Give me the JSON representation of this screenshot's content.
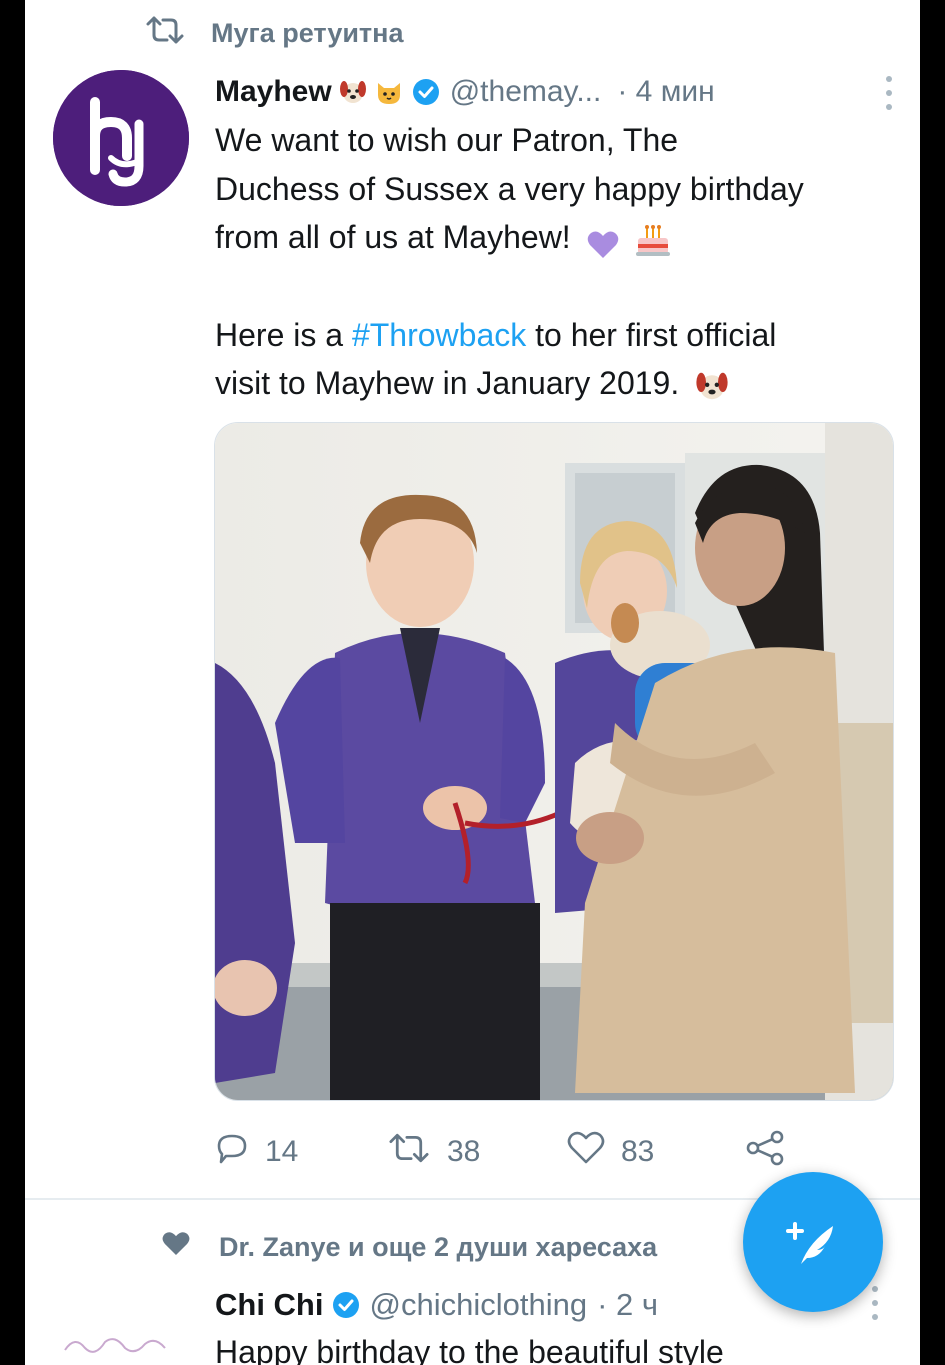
{
  "retweet_note": "Мyга ретуитна",
  "tweet": {
    "author": {
      "name": "Mayhew",
      "handle": "@themay...",
      "time": "· 4 мин",
      "emojis": [
        "dog-face-icon",
        "cat-face-icon"
      ],
      "avatar_color": "#4d1e7b"
    },
    "text_line1": "We want to wish our Patron, The",
    "text_line2": "Duchess of Sussex a very happy birthday",
    "text_line3": "from all of us at Mayhew!",
    "text_line3_emojis": [
      "purple-heart-icon",
      "birthday-cake-icon"
    ],
    "text_line4_prefix": "Here is a ",
    "hashtag": "#Throwback",
    "text_line4_suffix": " to her first official",
    "text_line5": "visit to Mayhew in January 2019.",
    "text_line5_emoji": "dog-face-icon",
    "media_description": "photo",
    "stats": {
      "replies": "14",
      "retweets": "38",
      "likes": "83"
    }
  },
  "like_note": "Dr. Zanye и още 2 души харесаха",
  "next_tweet": {
    "name": "Chi Chi",
    "handle": "@chichiclothing",
    "time": "· 2 ч",
    "text_partial": "Happy birthday to the beautiful style"
  },
  "colors": {
    "accent": "#1da1f2",
    "muted": "#657786",
    "brand_purple": "#4d1e7b"
  }
}
